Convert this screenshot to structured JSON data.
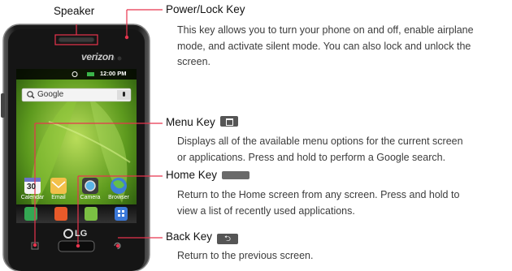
{
  "phone": {
    "speaker_label": "Speaker",
    "carrier": "verizon",
    "status_time": "12:00 PM",
    "search_placeholder": "Google",
    "calendar_day": "30",
    "apps": [
      "Calendar",
      "Email",
      "Camera",
      "Browser"
    ],
    "brand": "LG"
  },
  "callouts": [
    {
      "title": "Power/Lock Key",
      "icon": "",
      "desc": [
        "This key allows you to turn your phone on and off, enable airplane",
        "mode, and activate silent mode. You can also lock and unlock the",
        "screen."
      ]
    },
    {
      "title": "Menu Key",
      "icon": "menu-key-icon",
      "desc": [
        "Displays all of the available menu options for the current screen",
        "or applications. Press and hold to perform a Google search."
      ]
    },
    {
      "title": "Home Key",
      "icon": "home-key-icon",
      "desc": [
        "Return to the Home screen from any screen. Press and hold to",
        "view a list of recently used applications."
      ]
    },
    {
      "title": "Back Key",
      "icon": "back-key-icon",
      "desc": [
        "Return to the previous screen."
      ]
    }
  ],
  "colors": {
    "callout_line": "#e8344e",
    "phone_body": "#1c1c1c",
    "key_icon": "#555555"
  }
}
